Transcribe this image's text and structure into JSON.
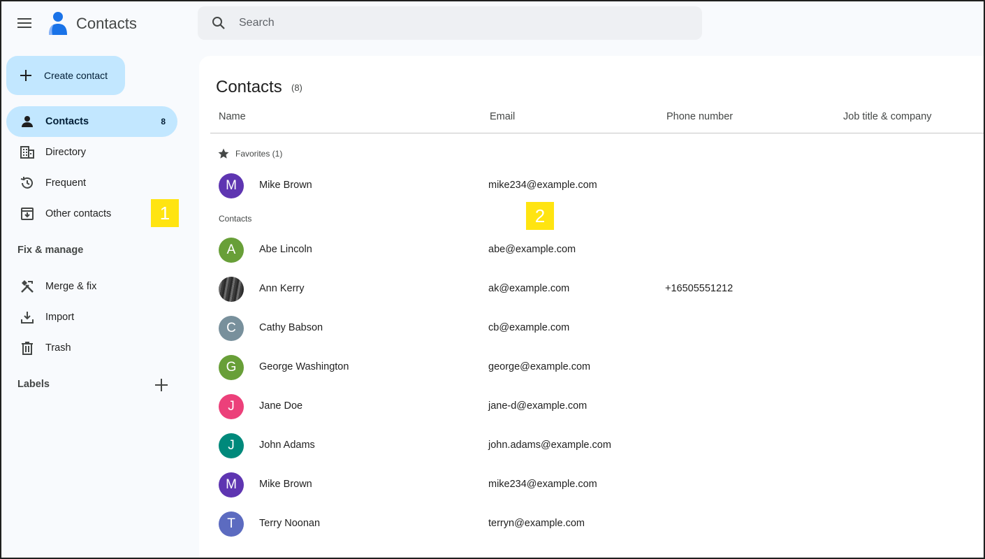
{
  "app": {
    "title": "Contacts",
    "search_placeholder": "Search"
  },
  "sidebar": {
    "create_label": "Create contact",
    "items": [
      {
        "label": "Contacts",
        "count": "8",
        "icon": "person-icon"
      },
      {
        "label": "Directory",
        "icon": "directory-icon"
      },
      {
        "label": "Frequent",
        "icon": "history-icon"
      },
      {
        "label": "Other contacts",
        "icon": "archive-download-icon"
      }
    ],
    "fix_manage_header": "Fix & manage",
    "fix_items": [
      {
        "label": "Merge & fix",
        "icon": "merge-fix-icon"
      },
      {
        "label": "Import",
        "icon": "download-icon"
      },
      {
        "label": "Trash",
        "icon": "trash-icon"
      }
    ],
    "labels_header": "Labels"
  },
  "callouts": [
    "1",
    "2"
  ],
  "main": {
    "title": "Contacts",
    "count": "(8)",
    "columns": [
      "Name",
      "Email",
      "Phone number",
      "Job title & company"
    ],
    "favorites_label": "Favorites (1)",
    "contacts_label": "Contacts",
    "favorites": [
      {
        "initial": "M",
        "name": "Mike Brown",
        "email": "mike234@example.com",
        "phone": "",
        "color": "#5e35b1"
      }
    ],
    "contacts": [
      {
        "initial": "A",
        "name": "Abe Lincoln",
        "email": "abe@example.com",
        "phone": "",
        "color": "#689f38"
      },
      {
        "initial": "",
        "name": "Ann Kerry",
        "email": "ak@example.com",
        "phone": "+16505551212",
        "color": "#3d3d3d"
      },
      {
        "initial": "C",
        "name": "Cathy Babson",
        "email": "cb@example.com",
        "phone": "",
        "color": "#78909c"
      },
      {
        "initial": "G",
        "name": "George Washington",
        "email": "george@example.com",
        "phone": "",
        "color": "#689f38"
      },
      {
        "initial": "J",
        "name": "Jane Doe",
        "email": "jane-d@example.com",
        "phone": "",
        "color": "#ec407a"
      },
      {
        "initial": "J",
        "name": "John Adams",
        "email": "john.adams@example.com",
        "phone": "",
        "color": "#00897b"
      },
      {
        "initial": "M",
        "name": "Mike Brown",
        "email": "mike234@example.com",
        "phone": "",
        "color": "#5e35b1"
      },
      {
        "initial": "T",
        "name": "Terry Noonan",
        "email": "terryn@example.com",
        "phone": "",
        "color": "#5c6bc0"
      }
    ]
  },
  "colors": {
    "accent": "#c2e7ff",
    "callout": "#ffe411"
  }
}
